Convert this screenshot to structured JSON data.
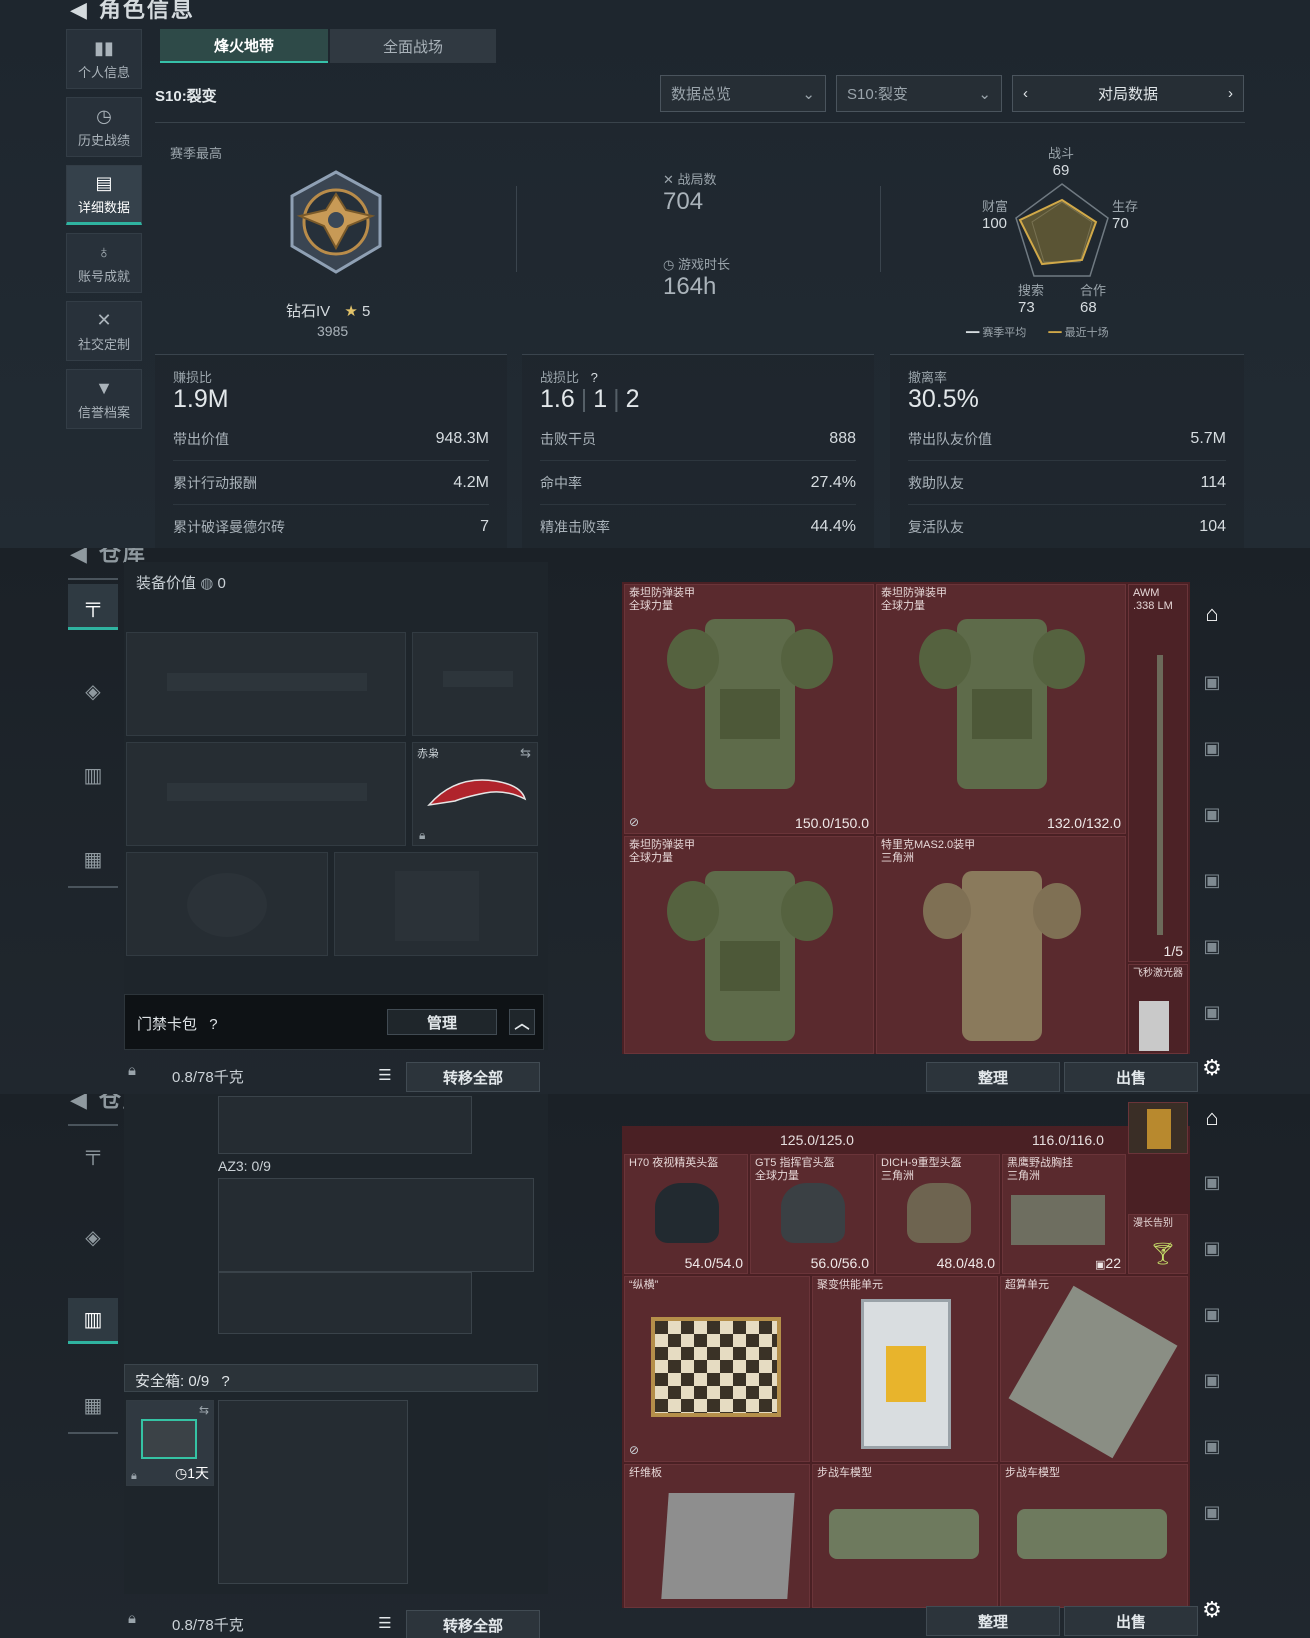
{
  "panel1": {
    "title": "角色信息",
    "nav": [
      {
        "icon": "bar-chart-icon",
        "label": "个人信息"
      },
      {
        "icon": "history-icon",
        "label": "历史战绩"
      },
      {
        "icon": "folder-icon",
        "label": "详细数据"
      },
      {
        "icon": "medal-icon",
        "label": "账号成就"
      },
      {
        "icon": "tools-icon",
        "label": "社交定制"
      },
      {
        "icon": "badge-icon",
        "label": "信誉档案"
      }
    ],
    "tabs": [
      "烽火地带",
      "全面战场"
    ],
    "season_label": "S10:裂变",
    "dropdowns": {
      "overview": "数据总览",
      "season": "S10:裂变"
    },
    "match_nav": "对局数据",
    "season_best": "赛季最高",
    "rank": {
      "name": "钻石IV",
      "stars": "5",
      "score": "3985"
    },
    "matches": {
      "label": "战局数",
      "value": "704"
    },
    "playtime": {
      "label": "游戏时长",
      "value": "164h"
    },
    "radar": {
      "top": {
        "label": "战斗",
        "value": "69"
      },
      "right_top": {
        "label": "生存",
        "value": "70"
      },
      "right_bottom": {
        "label": "合作",
        "value": "68"
      },
      "left_bottom": {
        "label": "搜索",
        "value": "73"
      },
      "left_top": {
        "label": "财富",
        "value": "100"
      },
      "legend": [
        "赛季平均",
        "最近十场"
      ]
    },
    "boxes": [
      {
        "title": "赚损比",
        "big": "1.9M",
        "rows": [
          [
            "带出价值",
            "948.3M"
          ],
          [
            "累计行动报酬",
            "4.2M"
          ],
          [
            "累计破译曼德尔砖",
            "7"
          ]
        ]
      },
      {
        "title": "战损比",
        "big": [
          "1.6",
          "1",
          "2"
        ],
        "rows": [
          [
            "击败干员",
            "888"
          ],
          [
            "命中率",
            "27.4%"
          ],
          [
            "精准击败率",
            "44.4%"
          ]
        ]
      },
      {
        "title": "撤离率",
        "big": "30.5%",
        "rows": [
          [
            "带出队友价值",
            "5.7M"
          ],
          [
            "救助队友",
            "114"
          ],
          [
            "复活队友",
            "104"
          ]
        ]
      }
    ]
  },
  "panel2": {
    "title": "仓库",
    "equip_label": "装备价值",
    "equip_value": "0",
    "knife_name": "赤枭",
    "keycard": "门禁卡包",
    "manage": "管理",
    "weight": "0.8/78千克",
    "transfer_all": "转移全部",
    "sort": "整理",
    "sell": "出售",
    "items": [
      {
        "name": "泰坦防弹装甲\n全球力量",
        "dur": "150.0/150.0"
      },
      {
        "name": "泰坦防弹装甲\n全球力量",
        "dur": "132.0/132.0"
      },
      {
        "name": "泰坦防弹装甲\n全球力量",
        "dur": ""
      },
      {
        "name": "特里克MAS2.0装甲\n三角洲",
        "dur": ""
      }
    ],
    "rifle": {
      "name": "AWM\n.338 LM",
      "count": "1/5"
    },
    "laser": "飞秒激光器"
  },
  "panel3": {
    "title": "仓库",
    "az3": "AZ3: 0/9",
    "safebox": "安全箱: 0/9",
    "safebox_time": "1天",
    "weight": "0.8/78千克",
    "transfer_all": "转移全部",
    "sort": "整理",
    "sell": "出售",
    "top_durs": [
      "125.0/125.0",
      "116.0/116.0"
    ],
    "helmets": [
      {
        "name": "H70 夜视精英头盔",
        "dur": "54.0/54.0"
      },
      {
        "name": "GT5 指挥官头盔\n全球力量",
        "dur": "56.0/56.0"
      },
      {
        "name": "DICH-9重型头盔\n三角洲",
        "dur": "48.0/48.0"
      },
      {
        "name": "黑鹰野战胸挂\n三角洲",
        "dur": "22"
      }
    ],
    "cocktail": "漫长告别",
    "valuables": [
      {
        "name": "“纵横”"
      },
      {
        "name": "聚变供能单元"
      },
      {
        "name": "超算单元"
      },
      {
        "name": "纤维板"
      },
      {
        "name": "步战车模型"
      },
      {
        "name": "步战车模型"
      }
    ]
  }
}
